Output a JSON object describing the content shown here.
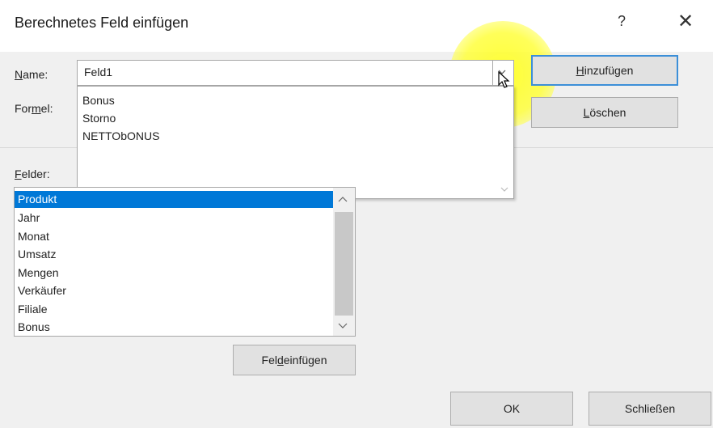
{
  "window": {
    "title": "Berechnetes Feld einfügen",
    "help_glyph": "?",
    "close_glyph": "✕"
  },
  "name": {
    "label": "Name:",
    "label_access": "N",
    "label_rest": "ame:",
    "value": "Feld1"
  },
  "formel": {
    "label_pre": "For",
    "label_access": "m",
    "label_post": "el:"
  },
  "dropdown_options": [
    "Bonus",
    "Storno",
    "NETTObONUS"
  ],
  "felder": {
    "label_access": "F",
    "label_rest": "elder:",
    "items": [
      "Produkt",
      "Jahr",
      "Monat",
      "Umsatz",
      "Mengen",
      "Verkäufer",
      "Filiale",
      "Bonus"
    ],
    "selected_index": 0
  },
  "buttons": {
    "hinzufuegen_access": "H",
    "hinzufuegen_rest": "inzufügen",
    "loeschen_access": "L",
    "loeschen_rest": "öschen",
    "feld_einfuegen_pre": "Fel",
    "feld_einfuegen_access": "d",
    "feld_einfuegen_post": " einfügen",
    "ok": "OK",
    "schliessen": "Schließen"
  },
  "colors": {
    "selection": "#0078d7",
    "highlight": "#ffff3c",
    "primary_border": "#3c8fd8"
  }
}
